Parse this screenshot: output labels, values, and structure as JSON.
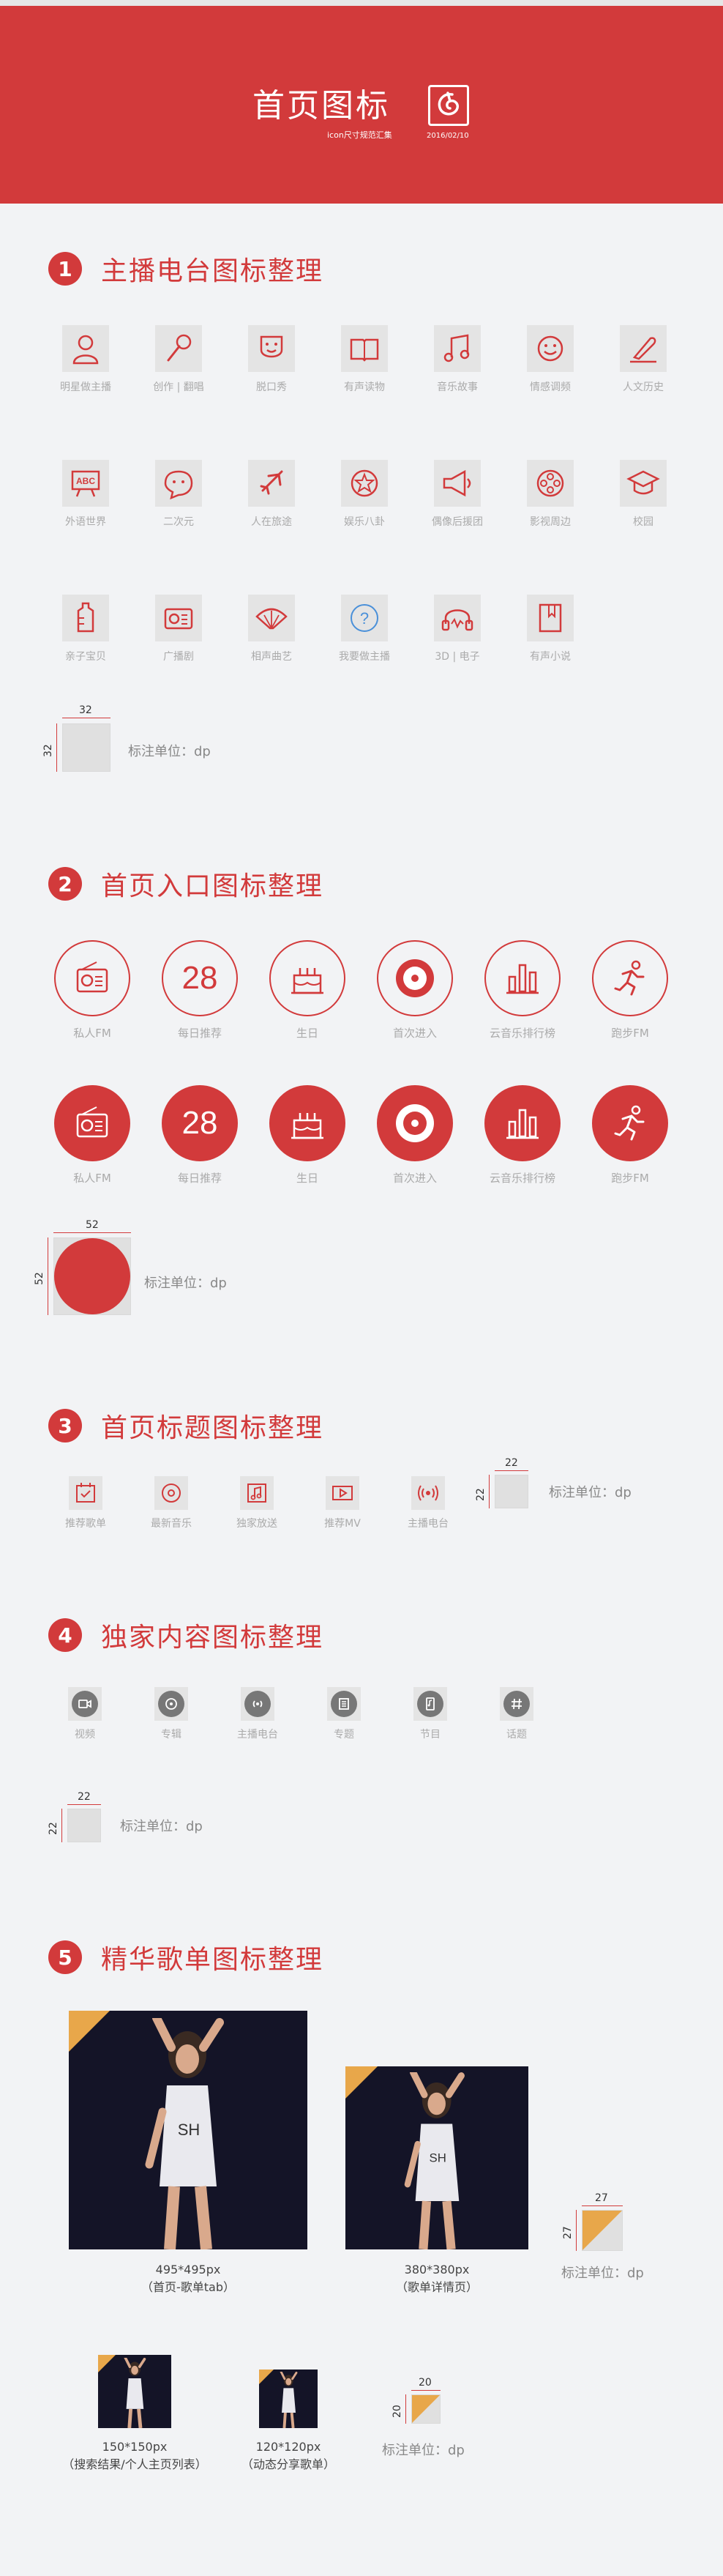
{
  "banner": {
    "title": "首页图标",
    "subtitle": "icon尺寸规范汇集",
    "date": "2016/02/10"
  },
  "sections": [
    {
      "num": "1",
      "title": "主播电台图标整理"
    },
    {
      "num": "2",
      "title": "首页入口图标整理"
    },
    {
      "num": "3",
      "title": "首页标题图标整理"
    },
    {
      "num": "4",
      "title": "独家内容图标整理"
    },
    {
      "num": "5",
      "title": "精华歌单图标整理"
    }
  ],
  "radio_icons": [
    {
      "label": "明星做主播",
      "icon": "person-icon"
    },
    {
      "label": "创作 | 翻唱",
      "icon": "microphone-icon"
    },
    {
      "label": "脱口秀",
      "icon": "mask-icon"
    },
    {
      "label": "有声读物",
      "icon": "book-icon"
    },
    {
      "label": "音乐故事",
      "icon": "music-note-icon"
    },
    {
      "label": "情感调频",
      "icon": "smile-icon"
    },
    {
      "label": "人文历史",
      "icon": "quill-icon"
    },
    {
      "label": "外语世界",
      "icon": "abc-board-icon"
    },
    {
      "label": "二次元",
      "icon": "chat-face-icon"
    },
    {
      "label": "人在旅途",
      "icon": "airplane-icon"
    },
    {
      "label": "娱乐八卦",
      "icon": "star-badge-icon"
    },
    {
      "label": "偶像后援团",
      "icon": "megaphone-icon"
    },
    {
      "label": "影视周边",
      "icon": "film-reel-icon"
    },
    {
      "label": "校园",
      "icon": "graduation-cap-icon"
    },
    {
      "label": "亲子宝贝",
      "icon": "baby-bottle-icon"
    },
    {
      "label": "广播剧",
      "icon": "radio-icon"
    },
    {
      "label": "相声曲艺",
      "icon": "fan-icon"
    },
    {
      "label": "我要做主播",
      "icon": "question-icon"
    },
    {
      "label": "3D | 电子",
      "icon": "headphones-icon"
    },
    {
      "label": "有声小说",
      "icon": "novel-icon"
    }
  ],
  "entry_icons": [
    {
      "label": "私人FM",
      "icon": "radio-icon"
    },
    {
      "label": "每日推荐",
      "icon": "calendar-28-icon",
      "number": "28"
    },
    {
      "label": "生日",
      "icon": "cake-icon"
    },
    {
      "label": "首次进入",
      "icon": "vinyl-icon"
    },
    {
      "label": "云音乐排行榜",
      "icon": "bar-chart-icon"
    },
    {
      "label": "跑步FM",
      "icon": "runner-icon"
    }
  ],
  "title_icons": [
    {
      "label": "推荐歌单",
      "icon": "playlist-icon"
    },
    {
      "label": "最新音乐",
      "icon": "disc-icon"
    },
    {
      "label": "独家放送",
      "icon": "music-box-icon"
    },
    {
      "label": "推荐MV",
      "icon": "video-play-icon"
    },
    {
      "label": "主播电台",
      "icon": "broadcast-icon"
    }
  ],
  "exclusive_icons": [
    {
      "label": "视频",
      "icon": "camera-icon"
    },
    {
      "label": "专辑",
      "icon": "album-icon"
    },
    {
      "label": "主播电台",
      "icon": "broadcast-icon"
    },
    {
      "label": "专题",
      "icon": "document-icon"
    },
    {
      "label": "节目",
      "icon": "phone-icon"
    },
    {
      "label": "话题",
      "icon": "hashtag-icon"
    }
  ],
  "dimensions": {
    "d32": "32",
    "d52": "52",
    "d22": "22",
    "d27": "27",
    "d20": "20",
    "unit_note": "标注单位：dp"
  },
  "covers": [
    {
      "size": "495*495px",
      "desc": "（首页-歌单tab）"
    },
    {
      "size": "380*380px",
      "desc": "（歌单详情页）"
    },
    {
      "size": "150*150px",
      "desc": "（搜索结果/个人主页列表）"
    },
    {
      "size": "120*120px",
      "desc": "（动态分享歌单）"
    }
  ],
  "colors": {
    "brand_red": "#d23a3b",
    "corner_orange": "#e8a74a",
    "background": "#f2f3f5"
  }
}
